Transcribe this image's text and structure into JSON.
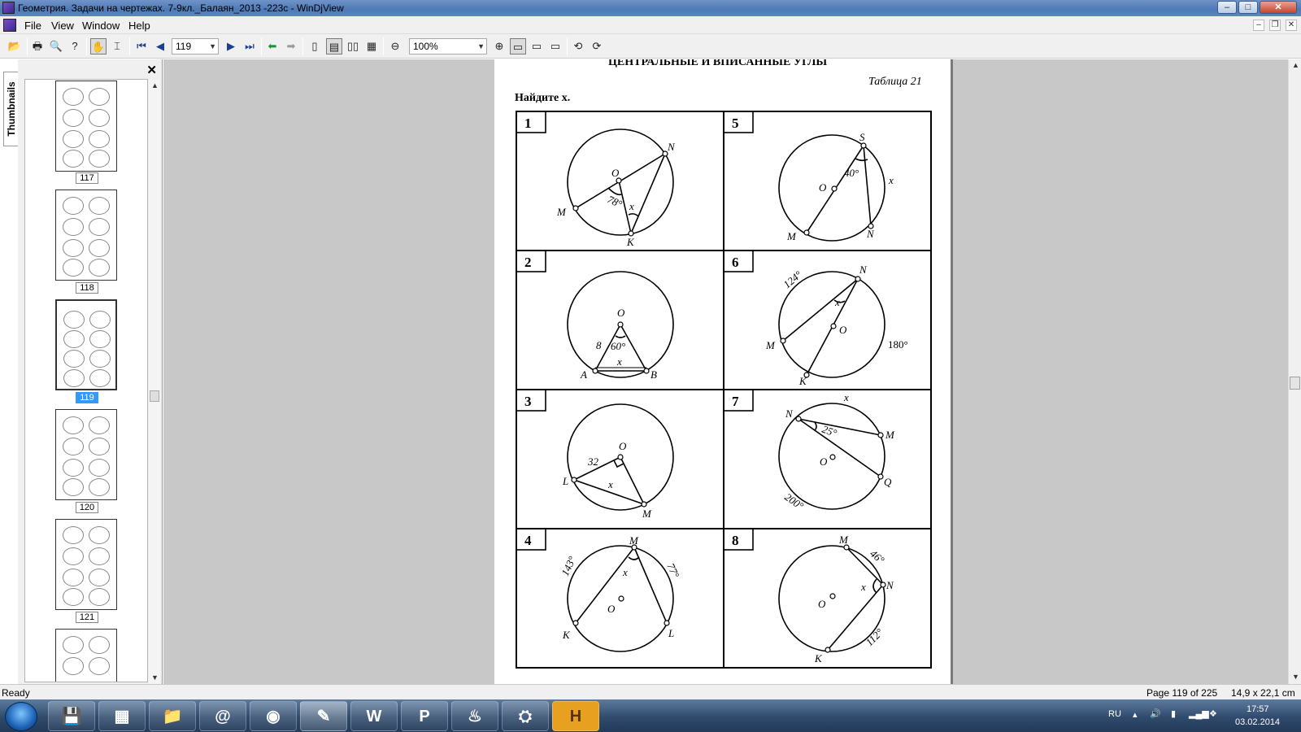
{
  "window": {
    "title": "Геометрия. Задачи на чертежах. 7-9кл._Балаян_2013 -223с - WinDjView",
    "buttons": {
      "minimize": "–",
      "maximize": "□",
      "close": "✕"
    }
  },
  "menu": {
    "items": [
      "File",
      "View",
      "Window",
      "Help"
    ],
    "mdi_buttons": {
      "minimize": "–",
      "restore": "❐",
      "close": "✕"
    }
  },
  "toolbar": {
    "page_number": "119",
    "zoom": "100%",
    "icons": [
      "open-icon",
      "print-icon",
      "find-icon",
      "help-icon",
      "hand-tool-icon",
      "select-tool-icon",
      "first-page-icon",
      "prev-page-icon",
      "next-page-icon",
      "last-page-icon",
      "back-icon",
      "forward-icon",
      "single-page-icon",
      "continuous-icon",
      "facing-icon",
      "continuous-facing-icon",
      "zoom-out-icon",
      "zoom-in-icon",
      "fit-page-icon",
      "fit-width-icon",
      "actual-size-icon",
      "rotate-left-icon",
      "rotate-right-icon"
    ]
  },
  "sidebar": {
    "tab_label": "Thumbnails",
    "close": "✕",
    "thumbnails": [
      {
        "label": "117",
        "selected": false
      },
      {
        "label": "118",
        "selected": false
      },
      {
        "label": "119",
        "selected": true
      },
      {
        "label": "120",
        "selected": false
      },
      {
        "label": "121",
        "selected": false
      },
      {
        "label": "",
        "selected": false
      }
    ]
  },
  "document": {
    "heading": "ЦЕНТРАЛЬНЫЕ И ВПИСАННЫЕ УГЛЫ",
    "table_label": "Таблица 21",
    "task": "Найдите x.",
    "problems": [
      {
        "n": "1",
        "labels": [
          "O",
          "N",
          "M",
          "K",
          "78°",
          "x"
        ]
      },
      {
        "n": "2",
        "labels": [
          "O",
          "60°",
          "8",
          "x",
          "A",
          "B"
        ]
      },
      {
        "n": "3",
        "labels": [
          "O",
          "32",
          "L",
          "x",
          "M"
        ]
      },
      {
        "n": "4",
        "labels": [
          "M",
          "143°",
          "77°",
          "x",
          "O",
          "K",
          "L"
        ]
      },
      {
        "n": "5",
        "labels": [
          "S",
          "40°",
          "x",
          "O",
          "M",
          "N"
        ]
      },
      {
        "n": "6",
        "labels": [
          "124°",
          "N",
          "x",
          "O",
          "M",
          "180°",
          "K"
        ]
      },
      {
        "n": "7",
        "labels": [
          "x",
          "N",
          "25°",
          "M",
          "O",
          "Q",
          "200°"
        ]
      },
      {
        "n": "8",
        "labels": [
          "M",
          "46°",
          "x",
          "N",
          "O",
          "K",
          "112°"
        ]
      }
    ]
  },
  "status": {
    "left": "Ready",
    "page": "Page 119 of 225",
    "size": "14,9 x 22,1 cm"
  },
  "taskbar": {
    "apps": [
      "save-app",
      "calculator-app",
      "explorer-app",
      "mail-agent-app",
      "chrome-app",
      "windjview-app",
      "word-app",
      "powerpoint-app",
      "flame-app",
      "network-app",
      "h-app"
    ],
    "h_label": "H",
    "language": "RU",
    "time": "17:57",
    "date": "03.02.2014"
  }
}
